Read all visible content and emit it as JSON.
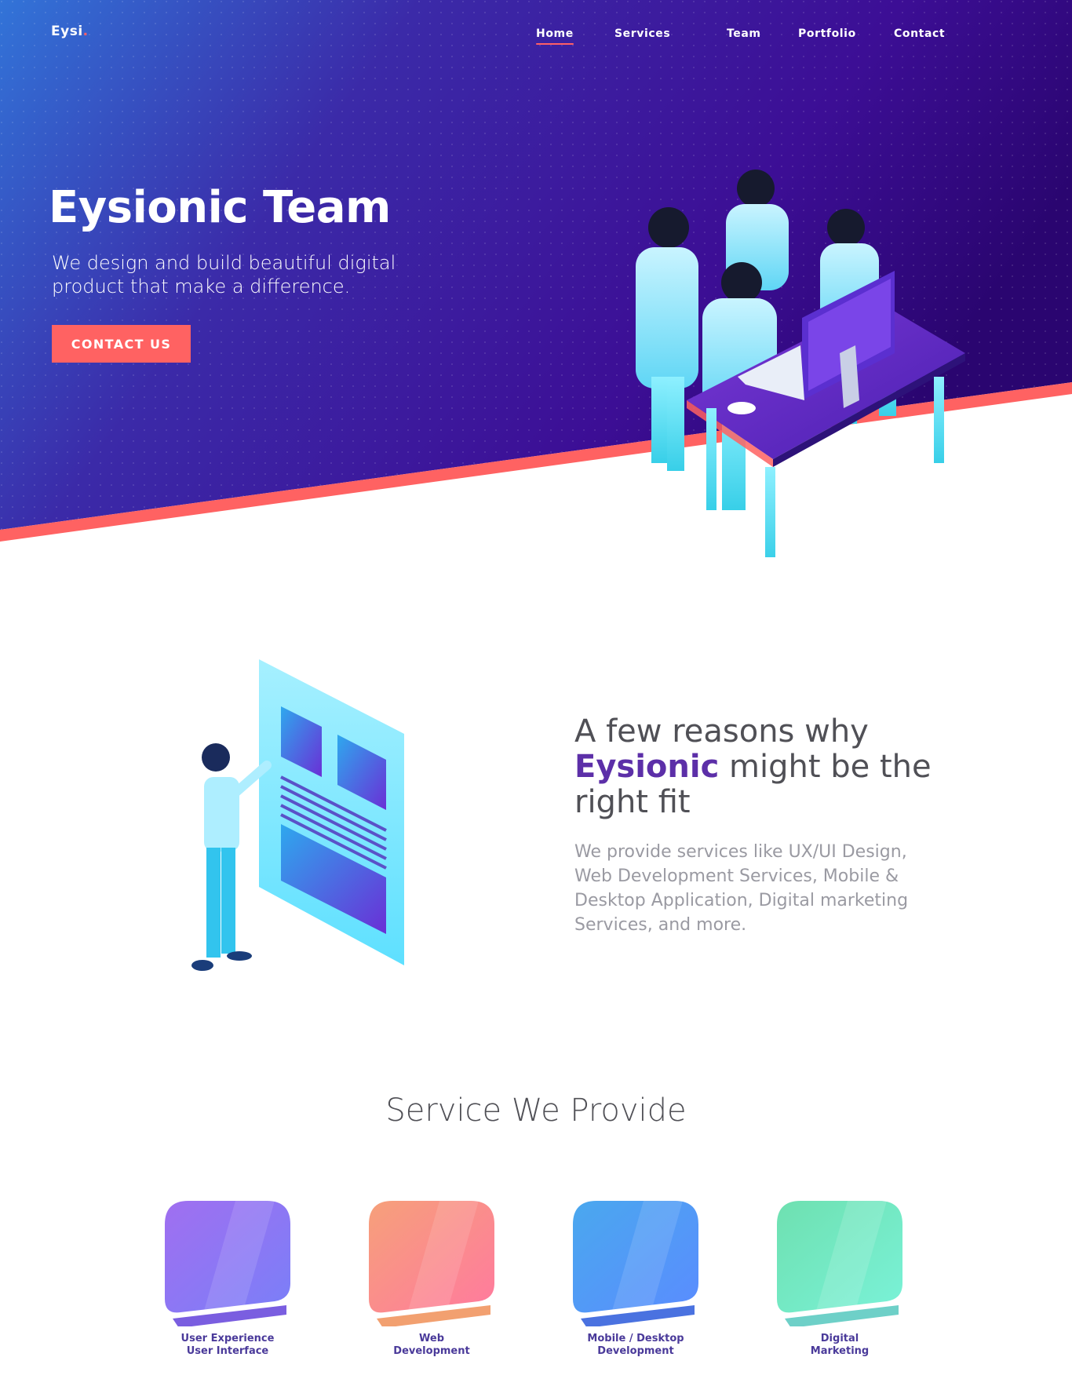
{
  "brand": {
    "logo_text": "Eysi",
    "logo_dot": "."
  },
  "nav": {
    "items": [
      {
        "label": "Home",
        "active": true
      },
      {
        "label": "Services",
        "active": false
      },
      {
        "label": "Team",
        "active": false
      },
      {
        "label": "Portfolio",
        "active": false
      },
      {
        "label": "Contact",
        "active": false
      }
    ]
  },
  "hero": {
    "title": "Eysionic Team",
    "subtitle": "We design and build beautiful digital product that make a difference.",
    "cta_label": "CONTACT US"
  },
  "reasons": {
    "title_start": "A few reasons why",
    "title_brand": "Eysionic",
    "title_end": "might be the right fit",
    "body": "We provide services like UX/UI Design, Web Development Services, Mobile & Desktop Application, Digital marketing Services, and more."
  },
  "services": {
    "title": "Service We Provide",
    "items": [
      {
        "line1": "User Experience",
        "line2": "User Interface"
      },
      {
        "line1": "Web",
        "line2": "Development"
      },
      {
        "line1": "Mobile / Desktop",
        "line2": "Development"
      },
      {
        "line1": "Digital",
        "line2": "Marketing"
      }
    ]
  },
  "colors": {
    "accent": "#ff6262",
    "hero_gradient_start": "#2f6fd6",
    "hero_gradient_end": "#3a0a8a",
    "brand_text": "#5c2fa8"
  }
}
